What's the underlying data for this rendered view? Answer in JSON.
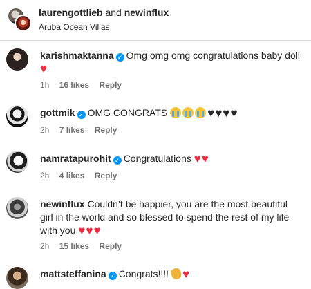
{
  "header": {
    "user_1": "laurengottlieb",
    "joiner": "and",
    "user_2": "newinflux",
    "location": "Aruba Ocean Villas"
  },
  "comments": [
    {
      "username": "karishmaktanna",
      "verified": true,
      "text": "Omg omg omg congratulations baby doll",
      "emojis": [
        "red-heart"
      ],
      "time": "1h",
      "likes": "16 likes",
      "reply": "Reply"
    },
    {
      "username": "gottmik",
      "verified": true,
      "text": "OMG CONGRATS",
      "emojis": [
        "crying-face",
        "crying-face",
        "crying-face",
        "black-heart",
        "black-heart",
        "black-heart",
        "black-heart"
      ],
      "time": "2h",
      "likes": "7 likes",
      "reply": "Reply"
    },
    {
      "username": "namratapurohit",
      "verified": true,
      "text": "Congratulations",
      "emojis": [
        "red-heart",
        "red-heart"
      ],
      "time": "2h",
      "likes": "4 likes",
      "reply": "Reply"
    },
    {
      "username": "newinflux",
      "verified": false,
      "text": "Couldn’t be happier, you are the most beautiful girl in the world and so blessed to spend the rest of my life with you",
      "emojis": [
        "red-heart",
        "red-heart",
        "red-heart"
      ],
      "time": "2h",
      "likes": "15 likes",
      "reply": "Reply"
    },
    {
      "username": "mattsteffanina",
      "verified": true,
      "text": "Congrats!!!!",
      "emojis": [
        "clapping-hands",
        "red-heart"
      ],
      "time": "",
      "likes": "",
      "reply": ""
    }
  ],
  "colors": {
    "verified": "#0095f6",
    "heart": "#ed2d3f",
    "meta_text": "#737373"
  }
}
